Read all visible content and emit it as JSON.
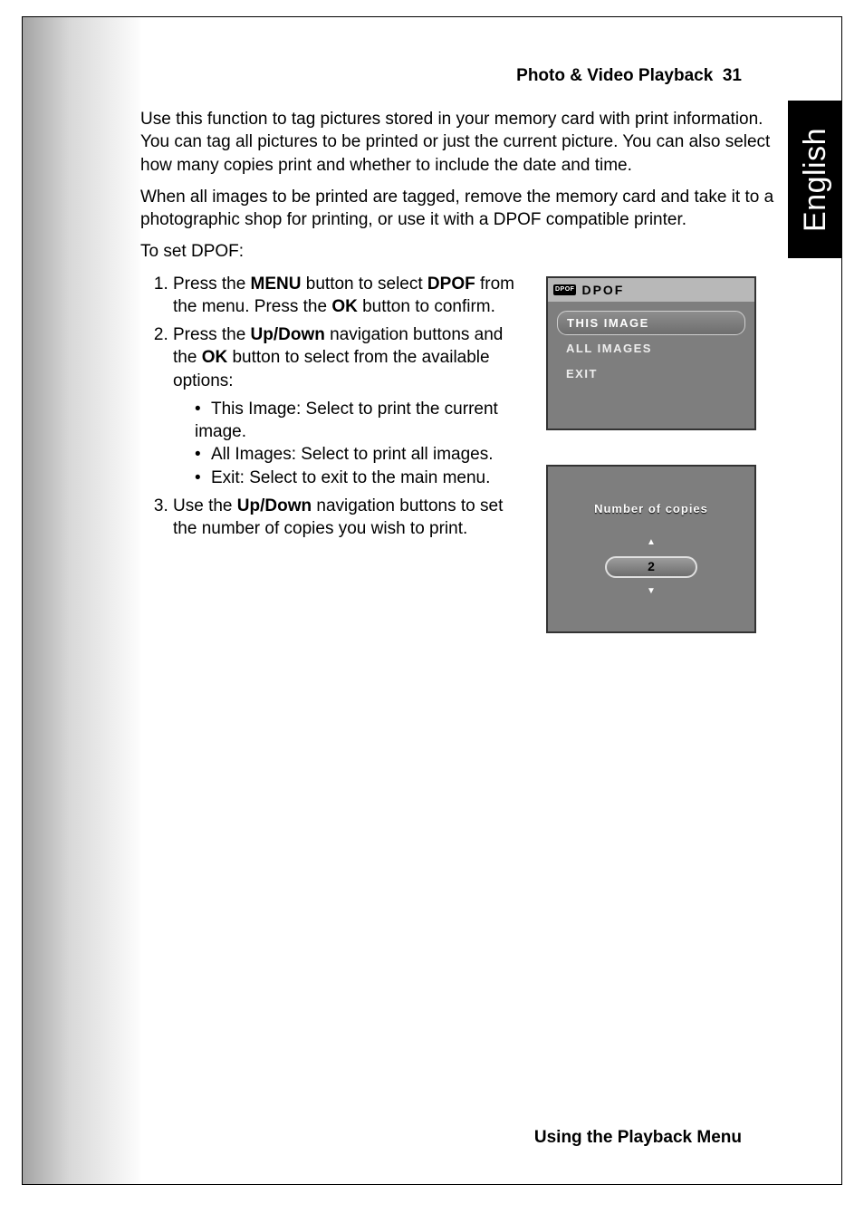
{
  "header": {
    "section": "Photo & Video Playback",
    "page": "31"
  },
  "language_tab": "English",
  "paragraphs": {
    "p1": "Use this function to tag pictures stored in your memory card with print information. You can tag all pictures to be printed or just the current picture. You can also select how many copies print and whether to include the date and time.",
    "p2": "When all images to be printed are tagged, remove the memory card and take it to a photographic shop for printing, or use it with a DPOF compatible printer.",
    "p3": "To set DPOF:"
  },
  "steps": {
    "s1a": "Press the ",
    "s1_menu": "MENU",
    "s1b": " button to select ",
    "s1_dpof": "DPOF",
    "s1c": " from the menu. Press the ",
    "s1_ok": "OK",
    "s1d": " button to confirm.",
    "s2a": "Press the ",
    "s2_ud": "Up/Down",
    "s2b": " navigation buttons and the ",
    "s2_ok": "OK",
    "s2c": " button to select from the available options:",
    "s2_opts": {
      "o1": "This Image: Select to print the current image.",
      "o2": "All Images: Select to print all images.",
      "o3": "Exit: Select to exit to the main menu."
    },
    "s3a": "Use the ",
    "s3_ud": "Up/Down",
    "s3b": " navigation buttons to set the number of copies you wish to print."
  },
  "device_menu": {
    "badge": "DPOF",
    "title": "DPOF",
    "items": [
      "THIS IMAGE",
      "ALL IMAGES",
      "EXIT"
    ]
  },
  "device_copies": {
    "title": "Number of copies",
    "value": "2"
  },
  "footer": "Using the Playback Menu"
}
